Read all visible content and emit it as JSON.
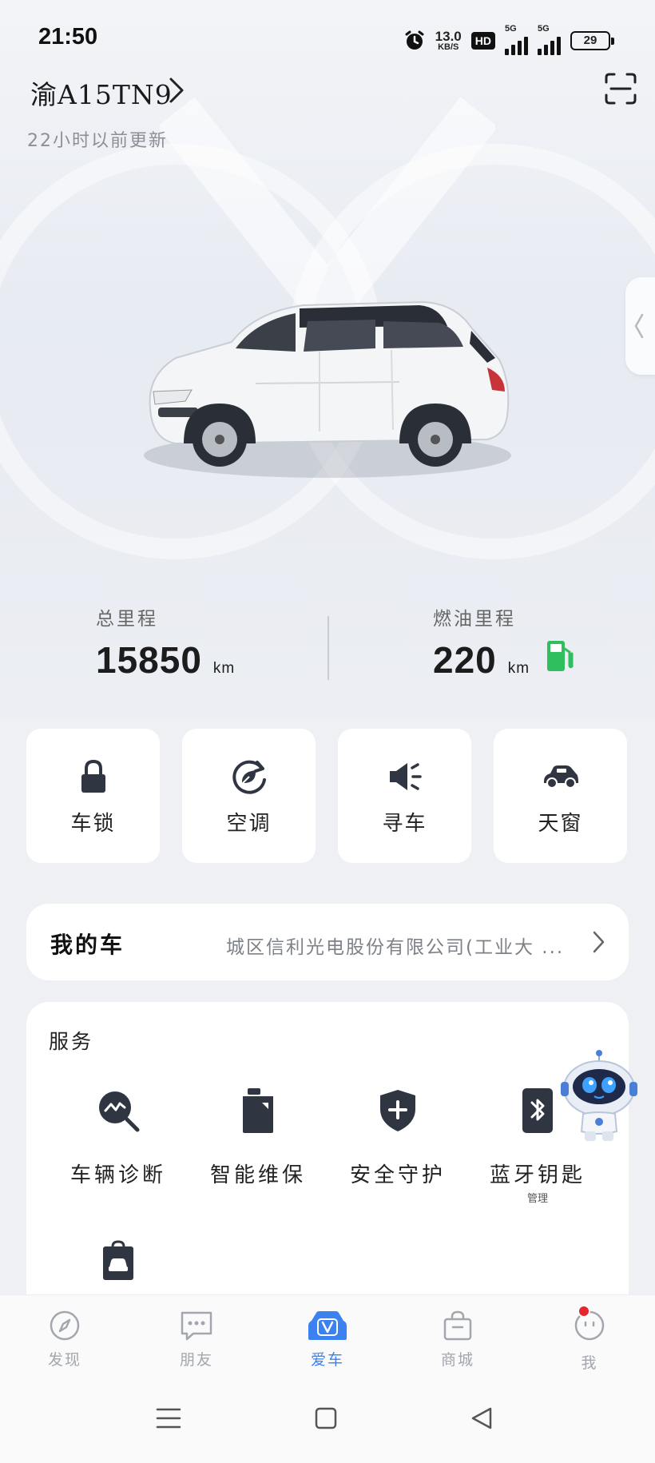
{
  "status_bar": {
    "time": "21:50",
    "net_speed_value": "13.0",
    "net_speed_unit": "KB/S",
    "hd_label": "HD",
    "signal1_label": "5G",
    "signal2_label": "5G",
    "battery": "29"
  },
  "header": {
    "plate": "渝A15TN9",
    "updated": "22小时以前更新"
  },
  "mileage": {
    "total_label": "总里程",
    "total_value": "15850",
    "total_unit": "km",
    "fuel_label": "燃油里程",
    "fuel_value": "220",
    "fuel_unit": "km",
    "fuel_icon": "fuel-pump-icon",
    "fuel_color": "#2fbf5e"
  },
  "controls": [
    {
      "label": "车锁",
      "icon": "lock-icon"
    },
    {
      "label": "空调",
      "icon": "air-conditioner-icon"
    },
    {
      "label": "寻车",
      "icon": "horn-icon"
    },
    {
      "label": "天窗",
      "icon": "sunroof-car-icon"
    }
  ],
  "my_car": {
    "title": "我的车",
    "address": "城区信利光电股份有限公司(工业大 ..."
  },
  "services": {
    "title": "服务",
    "items": [
      {
        "label": "车辆诊断",
        "icon": "diagnosis-icon"
      },
      {
        "label": "智能维保",
        "icon": "maintenance-icon"
      },
      {
        "label": "安全守护",
        "icon": "shield-plus-icon"
      },
      {
        "label": "蓝牙钥匙",
        "sub": "管理",
        "icon": "bluetooth-key-icon"
      },
      {
        "label": "",
        "icon": "car-shop-icon"
      }
    ]
  },
  "tabbar": {
    "items": [
      {
        "label": "发现",
        "icon": "compass-icon"
      },
      {
        "label": "朋友",
        "icon": "chat-icon"
      },
      {
        "label": "爱车",
        "icon": "car-v-icon",
        "active": true
      },
      {
        "label": "商城",
        "icon": "shopping-bag-icon"
      },
      {
        "label": "我",
        "icon": "profile-face-icon"
      }
    ],
    "active_color": "#3b82f0"
  }
}
